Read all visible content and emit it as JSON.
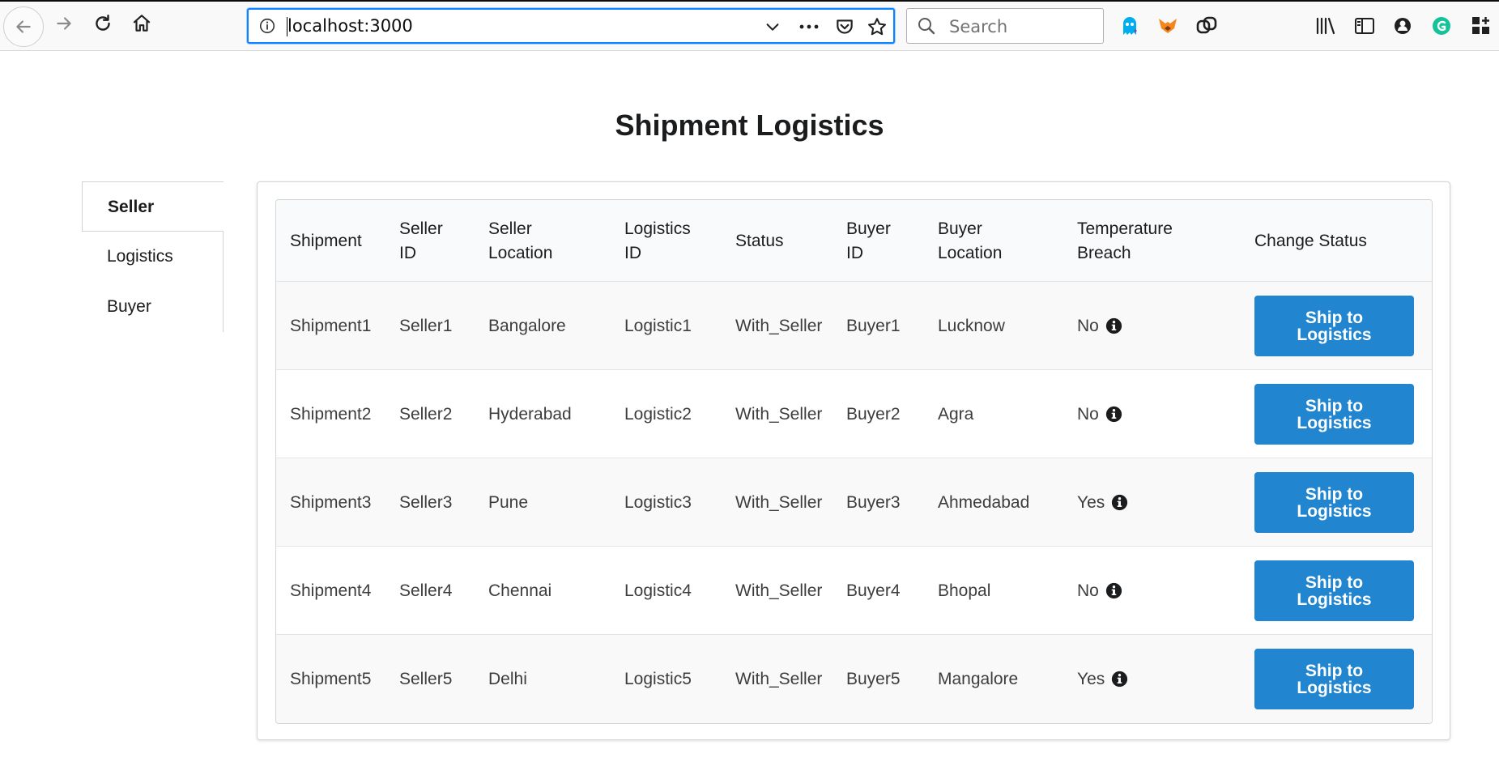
{
  "browser": {
    "url": "localhost:3000",
    "search_placeholder": "Search"
  },
  "page": {
    "title": "Shipment Logistics"
  },
  "menu": {
    "items": [
      {
        "label": "Seller",
        "active": true
      },
      {
        "label": "Logistics",
        "active": false
      },
      {
        "label": "Buyer",
        "active": false
      }
    ]
  },
  "table": {
    "headers": [
      "Shipment",
      "Seller\nID",
      "Seller\nLocation",
      "Logistics\nID",
      "Status",
      "Buyer\nID",
      "Buyer\nLocation",
      "Temperature\nBreach",
      "Change Status"
    ],
    "rows": [
      {
        "shipment": "Shipment1",
        "seller_id": "Seller1",
        "seller_location": "Bangalore",
        "logistics_id": "Logistic1",
        "status": "With_Seller",
        "buyer_id": "Buyer1",
        "buyer_location": "Lucknow",
        "temperature_breach": "No",
        "action": "Ship to\nLogistics"
      },
      {
        "shipment": "Shipment2",
        "seller_id": "Seller2",
        "seller_location": "Hyderabad",
        "logistics_id": "Logistic2",
        "status": "With_Seller",
        "buyer_id": "Buyer2",
        "buyer_location": "Agra",
        "temperature_breach": "No",
        "action": "Ship to\nLogistics"
      },
      {
        "shipment": "Shipment3",
        "seller_id": "Seller3",
        "seller_location": "Pune",
        "logistics_id": "Logistic3",
        "status": "With_Seller",
        "buyer_id": "Buyer3",
        "buyer_location": "Ahmedabad",
        "temperature_breach": "Yes",
        "action": "Ship to\nLogistics"
      },
      {
        "shipment": "Shipment4",
        "seller_id": "Seller4",
        "seller_location": "Chennai",
        "logistics_id": "Logistic4",
        "status": "With_Seller",
        "buyer_id": "Buyer4",
        "buyer_location": "Bhopal",
        "temperature_breach": "No",
        "action": "Ship to\nLogistics"
      },
      {
        "shipment": "Shipment5",
        "seller_id": "Seller5",
        "seller_location": "Delhi",
        "logistics_id": "Logistic5",
        "status": "With_Seller",
        "buyer_id": "Buyer5",
        "buyer_location": "Mangalore",
        "temperature_breach": "Yes",
        "action": "Ship to\nLogistics"
      }
    ]
  },
  "colors": {
    "primary_button": "#2185d0",
    "url_focus": "#0a84ff"
  },
  "icons": {
    "info": "info-circle-icon"
  }
}
